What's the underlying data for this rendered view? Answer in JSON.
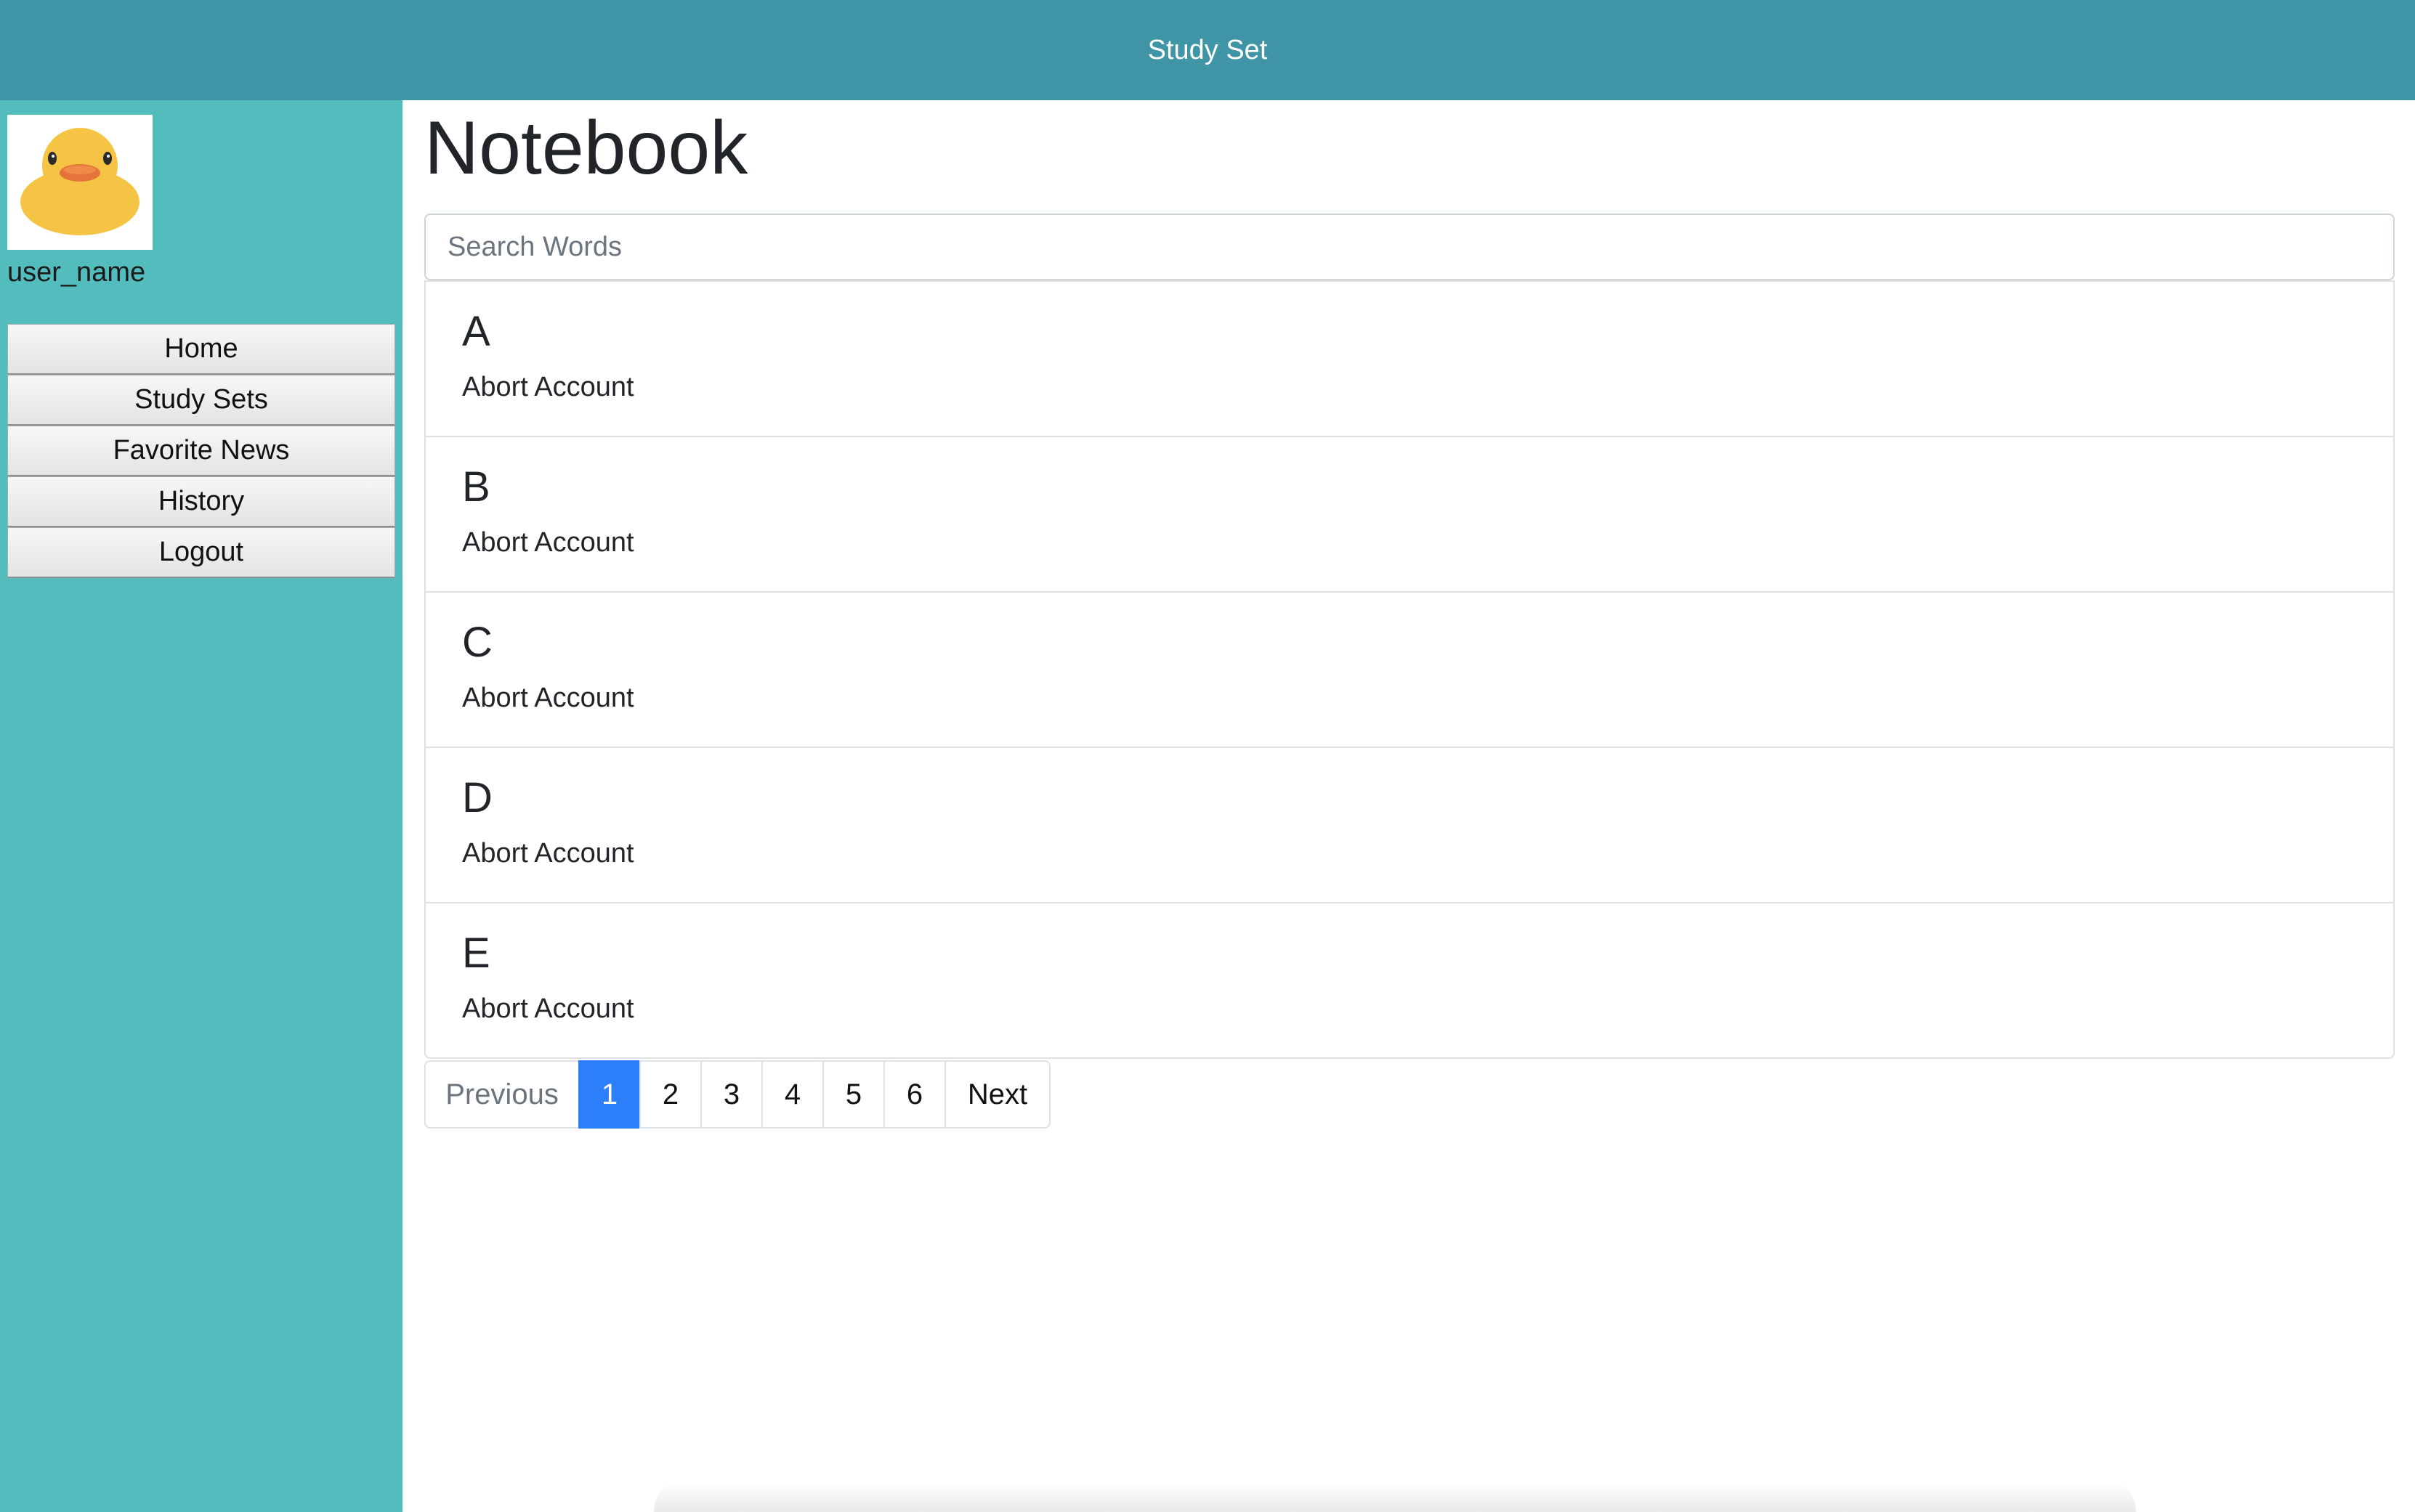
{
  "header": {
    "title": "Study Set"
  },
  "sidebar": {
    "avatar_icon": "rubber-duck-icon",
    "username": "user_name",
    "nav": [
      "Home",
      "Study Sets",
      "Favorite News",
      "History",
      "Logout"
    ]
  },
  "main": {
    "title": "Notebook",
    "search": {
      "placeholder": "Search Words",
      "value": ""
    },
    "groups": [
      {
        "letter": "A",
        "entry": "Abort Account"
      },
      {
        "letter": "B",
        "entry": "Abort Account"
      },
      {
        "letter": "C",
        "entry": "Abort Account"
      },
      {
        "letter": "D",
        "entry": "Abort Account"
      },
      {
        "letter": "E",
        "entry": "Abort Account"
      }
    ],
    "pagination": {
      "previous": "Previous",
      "pages": [
        "1",
        "2",
        "3",
        "4",
        "5",
        "6"
      ],
      "current": "1",
      "next": "Next"
    }
  },
  "colors": {
    "topbar": "#3f95a6",
    "sidebar": "#52bdbc",
    "active_page": "#2d7ff9"
  }
}
